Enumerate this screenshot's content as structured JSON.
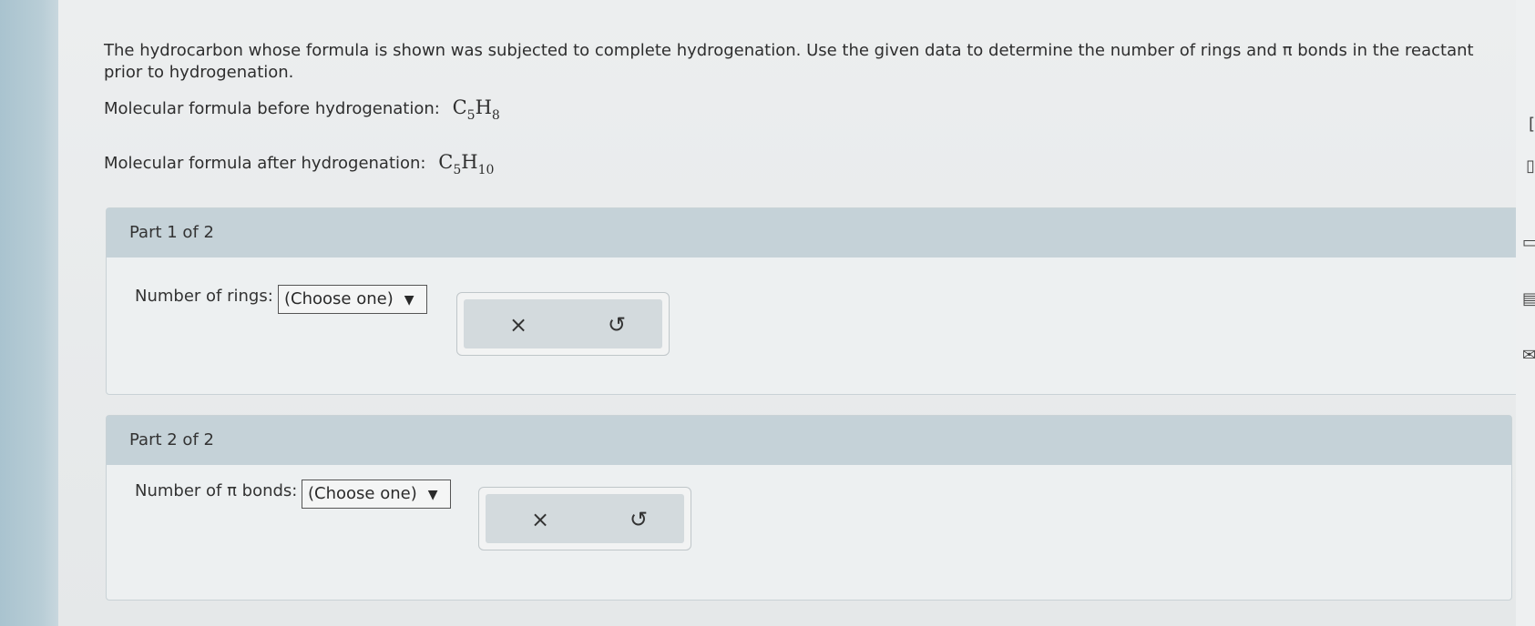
{
  "question": {
    "text": "The hydrocarbon whose formula is shown was subjected to complete hydrogenation. Use the given data to determine the number of rings and π bonds in the reactant prior to hydrogenation.",
    "before_label": "Molecular formula before hydrogenation:",
    "before_c": "C",
    "before_c_sub": "5",
    "before_h": "H",
    "before_h_sub": "8",
    "after_label": "Molecular formula after hydrogenation:",
    "after_c": "C",
    "after_c_sub": "5",
    "after_h": "H",
    "after_h_sub": "10"
  },
  "part1": {
    "header": "Part 1 of 2",
    "prompt": "Number of rings:",
    "select_value": "(Choose one)",
    "clear_symbol": "×",
    "undo_symbol": "↺"
  },
  "part2": {
    "header": "Part 2 of 2",
    "prompt": "Number of π bonds:",
    "select_value": "(Choose one)",
    "clear_symbol": "×",
    "undo_symbol": "↺"
  },
  "icons": {
    "dropdown": "chevron-down-icon",
    "clear": "close-icon",
    "undo": "undo-icon"
  }
}
